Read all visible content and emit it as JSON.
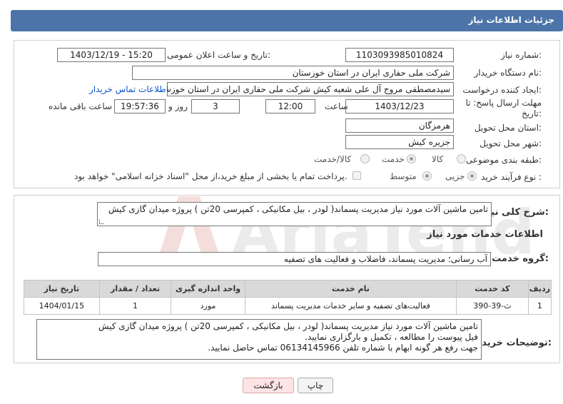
{
  "header": {
    "title": "جزئیات اطلاعات نیاز"
  },
  "fields": {
    "need_number_label": "شماره نیاز:",
    "need_number": "1103093985010824",
    "announce_label": "تاریخ و ساعت اعلان عمومی:",
    "announce_value": "1403/12/19 - 15:20",
    "buyer_org_label": "نام دستگاه خریدار:",
    "buyer_org": "شرکت ملی حفاری ایران در استان خوزستان",
    "creator_label": "ایجاد کننده درخواست:",
    "creator": "سیدمصطفی مروج آل علی شعبه کیش شرکت ملی حفاری ایران در استان خوزستان",
    "contact_link": "اطلاعات تماس خریدار",
    "deadline_label_1": "مهلت ارسال پاسخ: تا",
    "deadline_label_2": "تاریخ:",
    "deadline_date": "1403/12/23",
    "time_label": "ساعت",
    "deadline_time": "12:00",
    "days_value": "3",
    "days_label": "روز و",
    "remaining_time": "19:57:36",
    "remaining_label": "ساعت باقی مانده",
    "province_label": "استان محل تحویل:",
    "province": "هرمزگان",
    "city_label": "شهر محل تحویل:",
    "city": "جزیره کیش",
    "category_label": "طبقه بندی موضوعی:",
    "category_options": [
      "کالا",
      "خدمت",
      "کالا/خدمت"
    ],
    "category_selected": "خدمت",
    "process_label": "نوع فرآیند خرید :",
    "process_options": [
      "جزیی",
      "متوسط"
    ],
    "process_selected": "جزیی",
    "payment_note": "پرداخت تمام یا بخشی از مبلغ خرید،از محل \"اسناد خزانه اسلامی\" خواهد بود."
  },
  "summary": {
    "label": "شرح کلی نیاز:",
    "text": "تامین ماشین آلات مورد نیاز مدیریت پسماند( لودر ، بیل مکانیکی ، کمپرسی 20تن ) پروژه میدان گازی کیش"
  },
  "services": {
    "section_title": "اطلاعات خدمات مورد نیاز",
    "group_label": "گروه خدمت:",
    "group_value": "آب رسانی؛ مدیریت پسماند، فاضلاب و فعالیت های تصفیه",
    "columns": [
      "ردیف",
      "کد خدمت",
      "نام خدمت",
      "واحد اندازه گیری",
      "تعداد / مقدار",
      "تاریخ نیاز"
    ],
    "rows": [
      [
        "1",
        "ث-39-390",
        "فعالیت‌های تصفیه و سایر خدمات مدیریت پسماند",
        "مورد",
        "1",
        "1404/01/15"
      ]
    ]
  },
  "buyer_notes": {
    "label": "توضیحات خریدار:",
    "lines": [
      "تامین ماشین آلات مورد نیاز مدیریت پسماند( لودر ، بیل مکانیکی ، کمپرسی 20تن ) پروژه میدان گازی کیش",
      "فیل پیوست را مطالعه  ، تکمیل و بارگزاری نمایید.",
      "جهت رفع هر گونه ابهام با شماره تلفن 06134145966 تماس حاصل نمایید."
    ]
  },
  "buttons": {
    "print": "چاپ",
    "back": "بازگشت"
  },
  "watermark": {
    "text": "AriaTender.neT"
  }
}
